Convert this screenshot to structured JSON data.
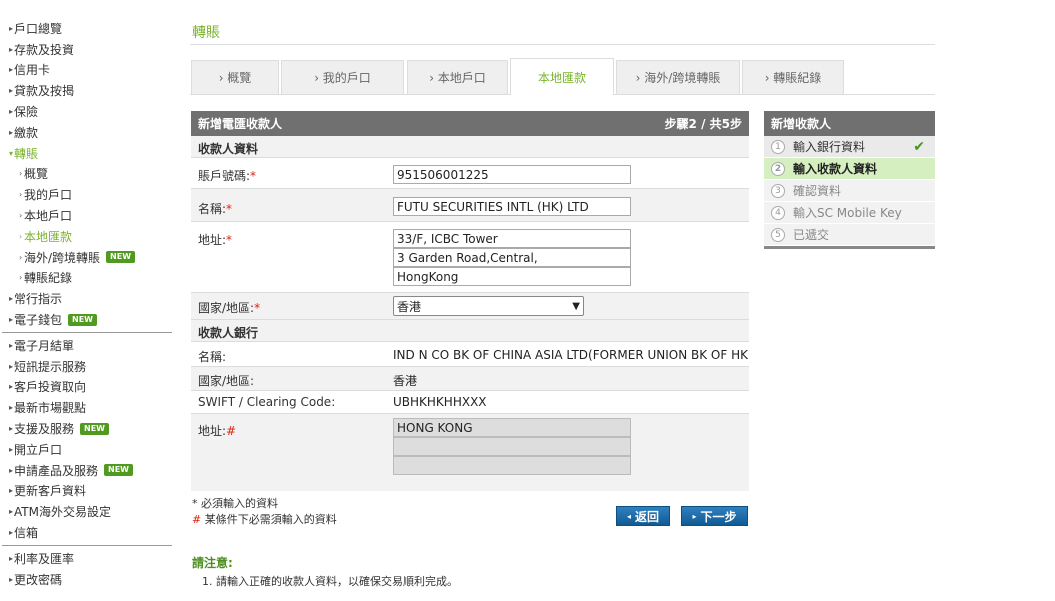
{
  "sidebar": {
    "items": [
      {
        "label": "戶口總覽"
      },
      {
        "label": "存款及投資"
      },
      {
        "label": "信用卡"
      },
      {
        "label": "貸款及按揭"
      },
      {
        "label": "保險"
      },
      {
        "label": "繳款"
      },
      {
        "label": "轉賬"
      }
    ],
    "sub_items": [
      {
        "label": "概覽"
      },
      {
        "label": "我的戶口"
      },
      {
        "label": "本地戶口"
      },
      {
        "label": "本地匯款"
      },
      {
        "label": "海外/跨境轉賬",
        "badge": "NEW"
      },
      {
        "label": "轉賬紀錄"
      }
    ],
    "items2": [
      {
        "label": "常行指示"
      },
      {
        "label": "電子錢包",
        "badge": "NEW"
      }
    ],
    "items3": [
      {
        "label": "電子月結單"
      },
      {
        "label": "短訊提示服務"
      },
      {
        "label": "客戶投資取向"
      },
      {
        "label": "最新市場觀點"
      },
      {
        "label": "支援及服務",
        "badge": "NEW"
      },
      {
        "label": "開立戶口"
      },
      {
        "label": "申請產品及服務",
        "badge": "NEW"
      },
      {
        "label": "更新客戶資料"
      },
      {
        "label": "ATM海外交易設定"
      },
      {
        "label": "信箱"
      }
    ],
    "items4": [
      {
        "label": "利率及匯率"
      },
      {
        "label": "更改密碼"
      }
    ]
  },
  "page_title": "轉賬",
  "tabs": [
    "› 概覽",
    "› 我的戶口",
    "› 本地戶口",
    "本地匯款",
    "› 海外/跨境轉賬",
    "› 轉賬紀錄"
  ],
  "form": {
    "header_title": "新增電匯收款人",
    "header_step": "步驟2 / 共5步",
    "section_payee": "收款人資料",
    "account_label": "賬戶號碼:",
    "account_value": "951506001225",
    "name_label": "名稱:",
    "name_value": "FUTU SECURITIES INTL (HK) LTD",
    "address_label": "地址:",
    "address_lines": [
      "33/F, ICBC Tower",
      "3 Garden Road,Central,",
      "HongKong"
    ],
    "country_label": "國家/地區:",
    "country_value": "香港",
    "section_bank": "收款人銀行",
    "bank_name_label": "名稱:",
    "bank_name_value": "IND N CO BK OF CHINA ASIA LTD(FORMER UNION BK OF HK",
    "bank_country_label": "國家/地區:",
    "bank_country_value": "香港",
    "swift_label": "SWIFT / Clearing Code:",
    "swift_value": "UBHKHKHHXXX",
    "bank_address_label": "地址:",
    "bank_address_lines": [
      "HONG KONG",
      "",
      ""
    ],
    "req_star": "*",
    "req_hash": "#"
  },
  "notes": {
    "required": "* 必須輸入的資料",
    "conditional_mark": "#",
    "conditional": "某條件下必需須輸入的資料"
  },
  "buttons": {
    "back": "返回",
    "next": "下一步"
  },
  "notice": {
    "title": "請注意:",
    "text": "1. 請輸入正確的收款人資料，以確保交易順利完成。"
  },
  "steps": {
    "title": "新增收款人",
    "items": [
      {
        "num": "1",
        "label": "輸入銀行資料",
        "state": "done"
      },
      {
        "num": "2",
        "label": "輸入收款人資料",
        "state": "current"
      },
      {
        "num": "3",
        "label": "確認資料",
        "state": "pending"
      },
      {
        "num": "4",
        "label": "輸入SC Mobile Key",
        "state": "pending"
      },
      {
        "num": "5",
        "label": "已遞交",
        "state": "pending"
      }
    ],
    "check": "✔"
  },
  "colors": {
    "accent_green": "#7ab32e",
    "header_grey": "#707070",
    "button_blue": "#1b6aa5",
    "badge_green": "#4f9a1f"
  }
}
